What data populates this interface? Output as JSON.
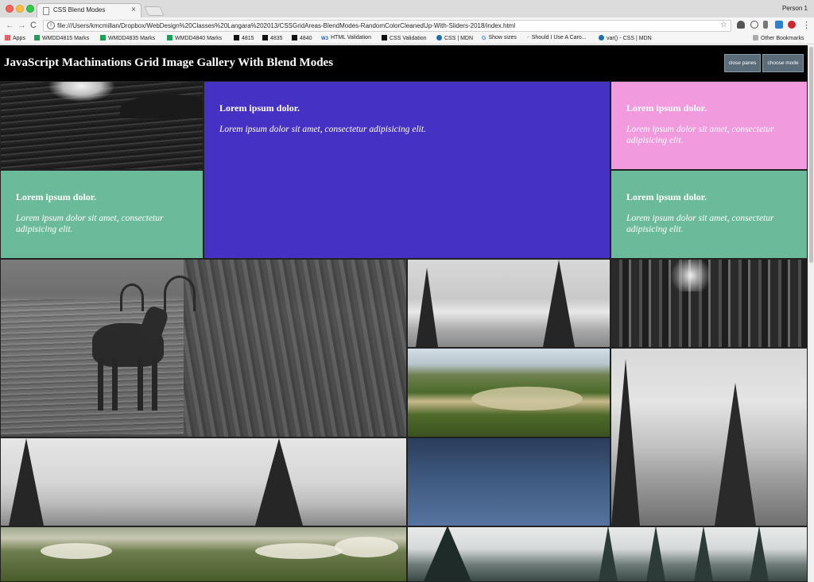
{
  "browser": {
    "tab_title": "CSS Blend Modes",
    "tab_close": "×",
    "person": "Person 1",
    "url": "file:///Users/kmcmillan/Dropbox/WebDesign%20Classes%20Langara%202013/CSSGridAreas-BlendModes-RandomColorCleanedUp-With-Sliders-2018/index.html",
    "nav": {
      "back": "←",
      "forward": "→",
      "reload": "C"
    },
    "info_glyph": "i",
    "star_glyph": "☆"
  },
  "bookmarks": [
    {
      "label": "Apps",
      "icon": "apps-grid-icon"
    },
    {
      "label": "WMDD4815 Marks",
      "icon": "sheets-icon"
    },
    {
      "label": "WMDD4835 Marks",
      "icon": "sheets-icon"
    },
    {
      "label": "WMDD4840 Marks",
      "icon": "sheets-icon"
    },
    {
      "label": "4815",
      "icon": "k-icon"
    },
    {
      "label": "4835",
      "icon": "k-icon"
    },
    {
      "label": "4840",
      "icon": "k-icon"
    },
    {
      "label": "HTML Validation",
      "icon": "w3c-icon",
      "glyph": "W3"
    },
    {
      "label": "CSS Validation",
      "icon": "validator-icon"
    },
    {
      "label": "CSS | MDN",
      "icon": "mdn-icon"
    },
    {
      "label": "Show sizes",
      "icon": "google-icon",
      "glyph": "G"
    },
    {
      "label": "Should I Use A Caro...",
      "icon": "caniuse-icon",
      "glyph": "◜"
    },
    {
      "label": "var() - CSS | MDN",
      "icon": "mdn-icon"
    },
    {
      "label": "Other Bookmarks",
      "icon": "folder-icon"
    }
  ],
  "header": {
    "title": "JavaScript Machinations Grid Image Gallery With Blend Modes",
    "close_panes": "close panes",
    "choose_mode": "choose mode"
  },
  "panels": {
    "heading": "Lorem ipsum dolor.",
    "text": "Lorem ipsum dolor sit amet, consectetur adipisicing elit."
  },
  "colors": {
    "header_bg": "#000000",
    "button_bg": "#5a6b79",
    "panel_purple": "#4532c4",
    "panel_pink": "#f19ade",
    "panel_green": "#6bbb9a"
  }
}
